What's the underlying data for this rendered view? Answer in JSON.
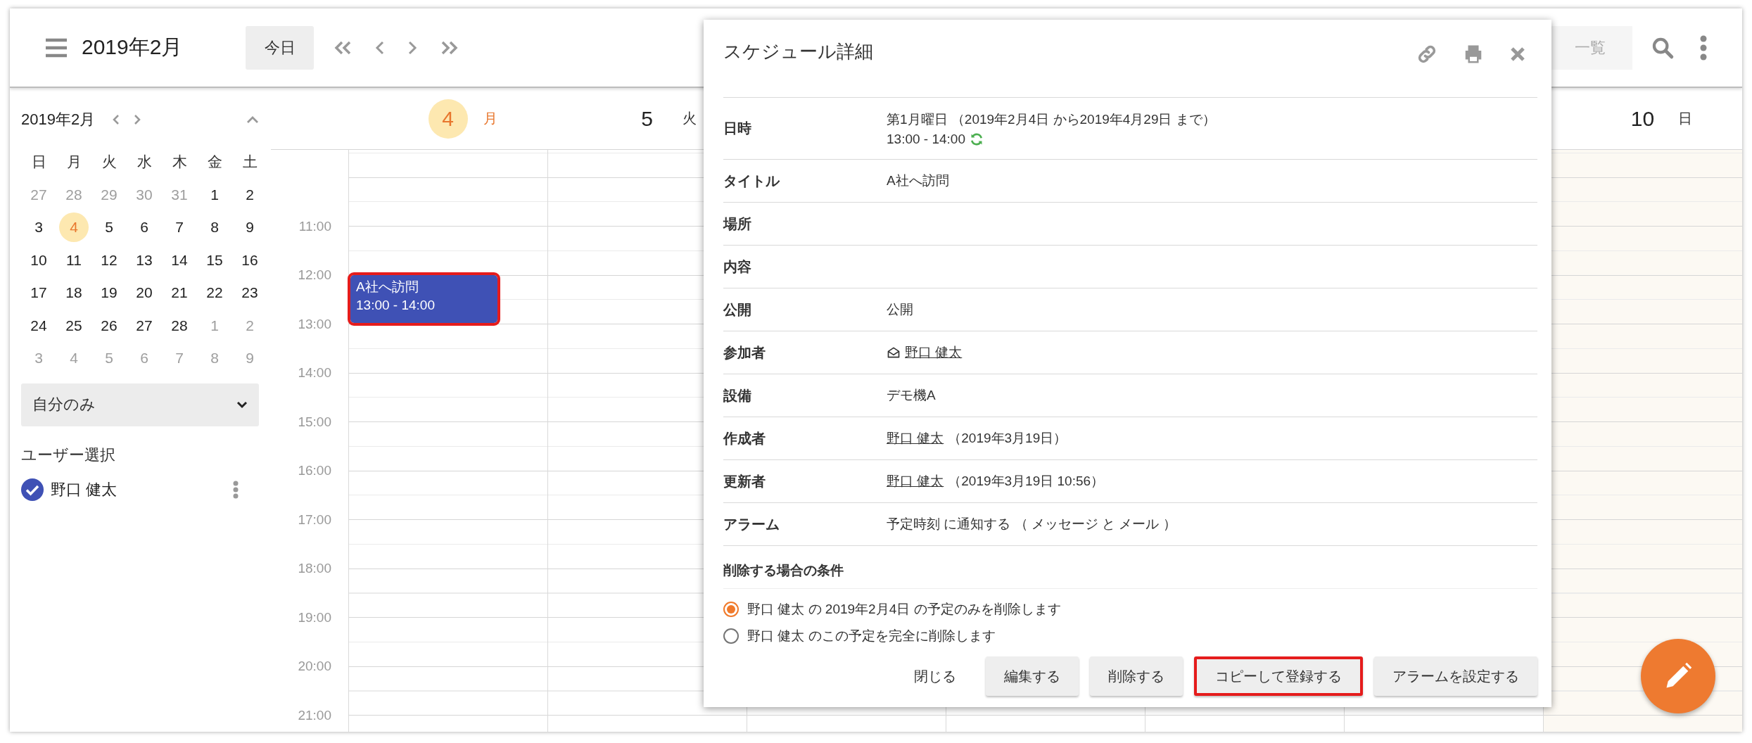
{
  "header": {
    "title": "2019年2月",
    "today_button": "今日",
    "list_button": "一覧"
  },
  "mini_calendar": {
    "title": "2019年2月",
    "weekdays": [
      "日",
      "月",
      "火",
      "水",
      "木",
      "金",
      "土"
    ],
    "weeks": [
      [
        {
          "day": "27",
          "in_month": false,
          "today": false
        },
        {
          "day": "28",
          "in_month": false,
          "today": false
        },
        {
          "day": "29",
          "in_month": false,
          "today": false
        },
        {
          "day": "30",
          "in_month": false,
          "today": false
        },
        {
          "day": "31",
          "in_month": false,
          "today": false
        },
        {
          "day": "1",
          "in_month": true,
          "today": false
        },
        {
          "day": "2",
          "in_month": true,
          "today": false
        }
      ],
      [
        {
          "day": "3",
          "in_month": true,
          "today": false
        },
        {
          "day": "4",
          "in_month": true,
          "today": true
        },
        {
          "day": "5",
          "in_month": true,
          "today": false
        },
        {
          "day": "6",
          "in_month": true,
          "today": false
        },
        {
          "day": "7",
          "in_month": true,
          "today": false
        },
        {
          "day": "8",
          "in_month": true,
          "today": false
        },
        {
          "day": "9",
          "in_month": true,
          "today": false
        }
      ],
      [
        {
          "day": "10",
          "in_month": true,
          "today": false
        },
        {
          "day": "11",
          "in_month": true,
          "today": false
        },
        {
          "day": "12",
          "in_month": true,
          "today": false
        },
        {
          "day": "13",
          "in_month": true,
          "today": false
        },
        {
          "day": "14",
          "in_month": true,
          "today": false
        },
        {
          "day": "15",
          "in_month": true,
          "today": false
        },
        {
          "day": "16",
          "in_month": true,
          "today": false
        }
      ],
      [
        {
          "day": "17",
          "in_month": true,
          "today": false
        },
        {
          "day": "18",
          "in_month": true,
          "today": false
        },
        {
          "day": "19",
          "in_month": true,
          "today": false
        },
        {
          "day": "20",
          "in_month": true,
          "today": false
        },
        {
          "day": "21",
          "in_month": true,
          "today": false
        },
        {
          "day": "22",
          "in_month": true,
          "today": false
        },
        {
          "day": "23",
          "in_month": true,
          "today": false
        }
      ],
      [
        {
          "day": "24",
          "in_month": true,
          "today": false
        },
        {
          "day": "25",
          "in_month": true,
          "today": false
        },
        {
          "day": "26",
          "in_month": true,
          "today": false
        },
        {
          "day": "27",
          "in_month": true,
          "today": false
        },
        {
          "day": "28",
          "in_month": true,
          "today": false
        },
        {
          "day": "1",
          "in_month": false,
          "today": false
        },
        {
          "day": "2",
          "in_month": false,
          "today": false
        }
      ],
      [
        {
          "day": "3",
          "in_month": false,
          "today": false
        },
        {
          "day": "4",
          "in_month": false,
          "today": false
        },
        {
          "day": "5",
          "in_month": false,
          "today": false
        },
        {
          "day": "6",
          "in_month": false,
          "today": false
        },
        {
          "day": "7",
          "in_month": false,
          "today": false
        },
        {
          "day": "8",
          "in_month": false,
          "today": false
        },
        {
          "day": "9",
          "in_month": false,
          "today": false
        }
      ]
    ]
  },
  "filter_select": {
    "value": "自分のみ"
  },
  "user_select": {
    "heading": "ユーザー選択",
    "users": [
      {
        "name": "野口 健太",
        "checked": true
      }
    ]
  },
  "week_view": {
    "days": [
      {
        "date": "4",
        "weekday": "月",
        "today": true,
        "kind": "weekday",
        "events": [
          {
            "title": "A社へ訪問",
            "time": "13:00 - 14:00",
            "highlighted": true
          }
        ]
      },
      {
        "date": "5",
        "weekday": "火",
        "today": false,
        "kind": "weekday"
      },
      {
        "kind": "weekday"
      },
      {
        "kind": "weekday"
      },
      {
        "kind": "weekday"
      },
      {
        "kind": "weekday"
      },
      {
        "date": "10",
        "weekday": "日",
        "today": false,
        "kind": "sunday"
      }
    ],
    "times": [
      "11:00",
      "12:00",
      "13:00",
      "14:00",
      "15:00",
      "16:00",
      "17:00",
      "18:00",
      "19:00",
      "20:00",
      "21:00"
    ]
  },
  "dialog": {
    "title": "スケジュール詳細",
    "fields": [
      {
        "label": "日時",
        "kind": "recurring",
        "value": "第1月曜日 （2019年2月4日 から2019年4月29日 まで）",
        "time": "13:00 - 14:00"
      },
      {
        "label": "タイトル",
        "kind": "text",
        "value": "A社へ訪問"
      },
      {
        "label": "場所",
        "kind": "text"
      },
      {
        "label": "内容",
        "kind": "text"
      },
      {
        "label": "公開",
        "kind": "text",
        "value": "公開"
      },
      {
        "label": "参加者",
        "kind": "attendee",
        "link": "野口 健太"
      },
      {
        "label": "設備",
        "kind": "text",
        "value": "デモ機A"
      },
      {
        "label": "作成者",
        "kind": "user",
        "link": "野口 健太",
        "note": "（2019年3月19日）"
      },
      {
        "label": "更新者",
        "kind": "user",
        "link": "野口 健太",
        "note": "（2019年3月19日 10:56）"
      },
      {
        "label": "アラーム",
        "kind": "text",
        "value": "予定時刻 に通知する （ メッセージ と メール ）"
      }
    ],
    "delete_section": {
      "heading": "削除する場合の条件",
      "options": [
        {
          "label": "野口 健太 の 2019年2月4日 の予定のみを削除します",
          "selected": true
        },
        {
          "label": "野口 健太 のこの予定を完全に削除します",
          "selected": false
        }
      ]
    },
    "buttons": [
      {
        "label": "閉じる",
        "kind": "flat",
        "highlighted": false
      },
      {
        "label": "編集する",
        "kind": "raised",
        "highlighted": false
      },
      {
        "label": "削除する",
        "kind": "raised",
        "highlighted": false
      },
      {
        "label": "コピーして登録する",
        "kind": "raised",
        "highlighted": true
      },
      {
        "label": "アラームを設定する",
        "kind": "raised",
        "highlighted": false
      }
    ]
  }
}
